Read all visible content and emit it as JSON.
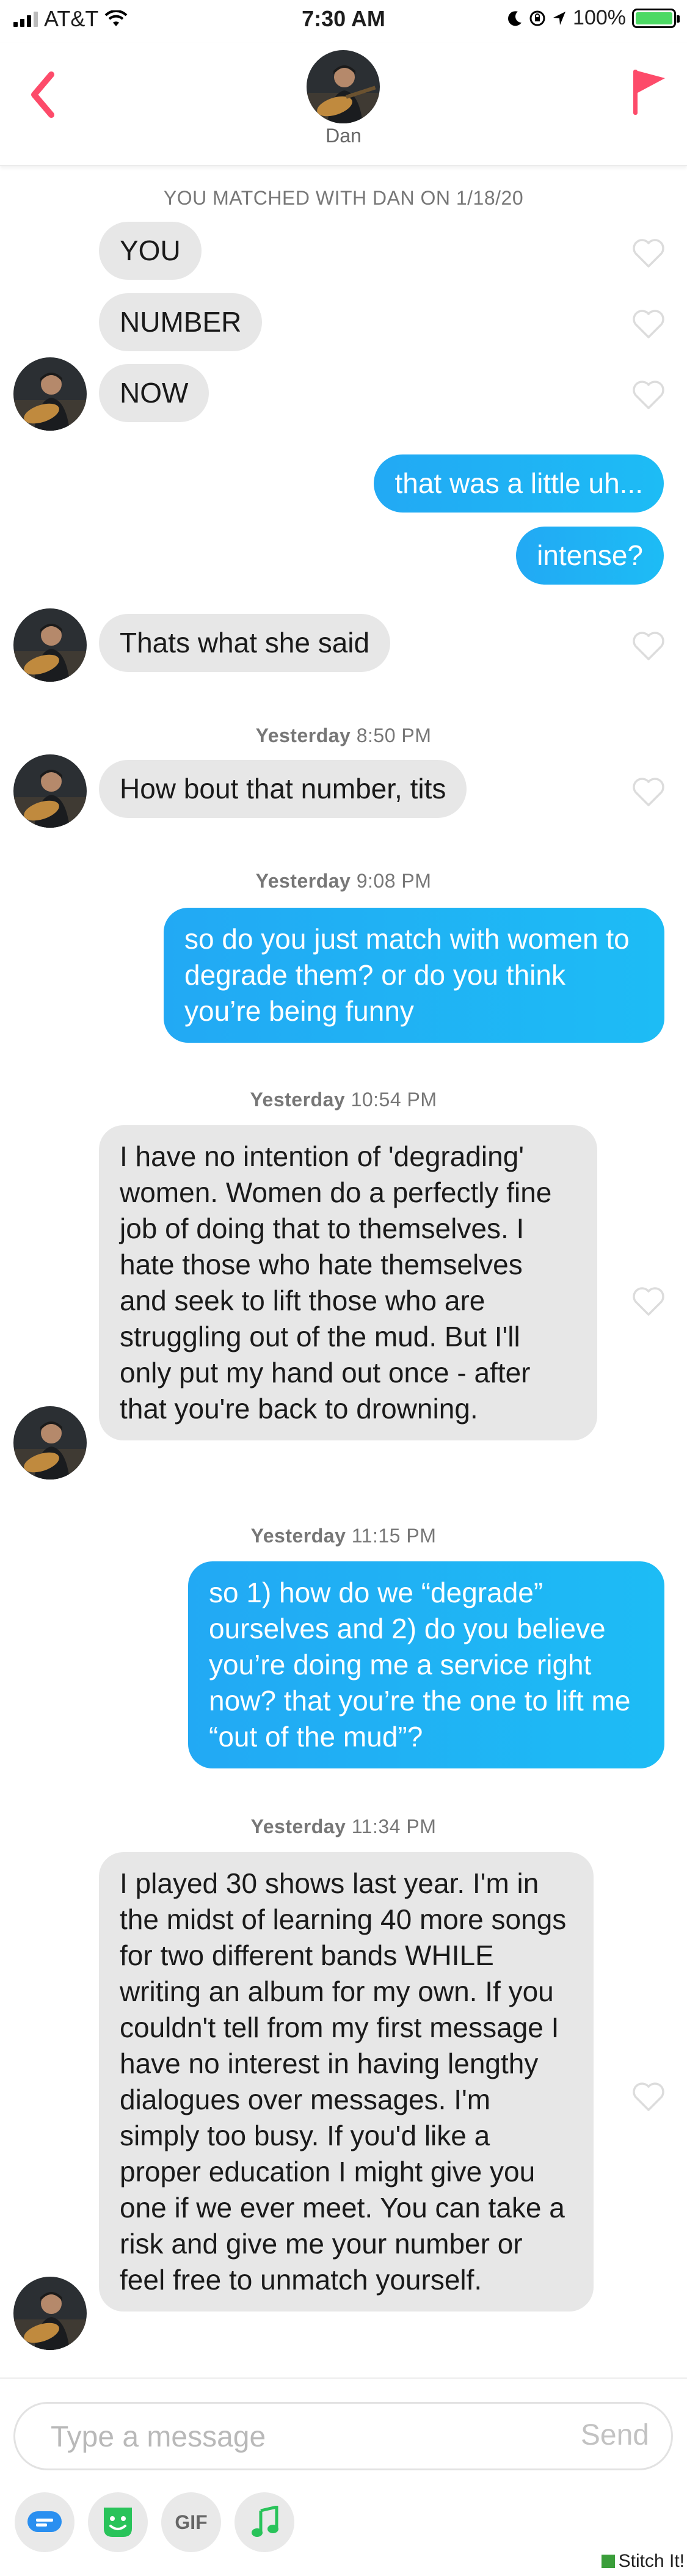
{
  "status_bar": {
    "carrier": "AT&T",
    "time": "7:30 AM",
    "battery": "100%"
  },
  "header": {
    "name": "Dan"
  },
  "conversation": {
    "match_notice": "YOU MATCHED WITH DAN ON 1/18/20",
    "messages": [
      {
        "text": "YOU"
      },
      {
        "text": "NUMBER"
      },
      {
        "text": "NOW"
      },
      {
        "text": "that was a little uh..."
      },
      {
        "text": "intense?"
      },
      {
        "text": "Thats what she said"
      },
      {
        "day": "Yesterday",
        "time": "8:50 PM"
      },
      {
        "text": "How bout that number, tits"
      },
      {
        "day": "Yesterday",
        "time": "9:08 PM"
      },
      {
        "text": "so do you just match with women to degrade them? or do you think you’re being funny"
      },
      {
        "day": "Yesterday",
        "time": "10:54 PM"
      },
      {
        "text": "I have no intention of 'degrading' women. Women do a perfectly fine job of doing that to themselves. I hate those who hate themselves and seek to lift those who are struggling out of the mud. But I'll only put my hand out once - after that you're back to drowning."
      },
      {
        "day": "Yesterday",
        "time": "11:15 PM"
      },
      {
        "text": "so 1) how do we “degrade” ourselves and 2) do you believe you’re doing me a service right now? that you’re the one to lift me “out of the mud”?"
      },
      {
        "day": "Yesterday",
        "time": "11:34 PM"
      },
      {
        "text": "I played 30 shows last year. I'm in the midst of learning 40 more songs for two different bands WHILE writing an album for my own. If you couldn't tell from my first message I have no interest in having lengthy dialogues over messages. I'm simply too busy. If you'd like a proper education I might give you one if we ever meet. You can take a risk and give me your number or feel free to unmatch yourself."
      }
    ]
  },
  "composer": {
    "placeholder": "Type a message",
    "send_label": "Send",
    "gif_label": "GIF"
  },
  "watermark": "Stitch It!",
  "colors": {
    "accent_red": "#fd4b6a",
    "bubble_blue": "#1fb0f4",
    "bubble_gray": "#e7e7e7"
  }
}
